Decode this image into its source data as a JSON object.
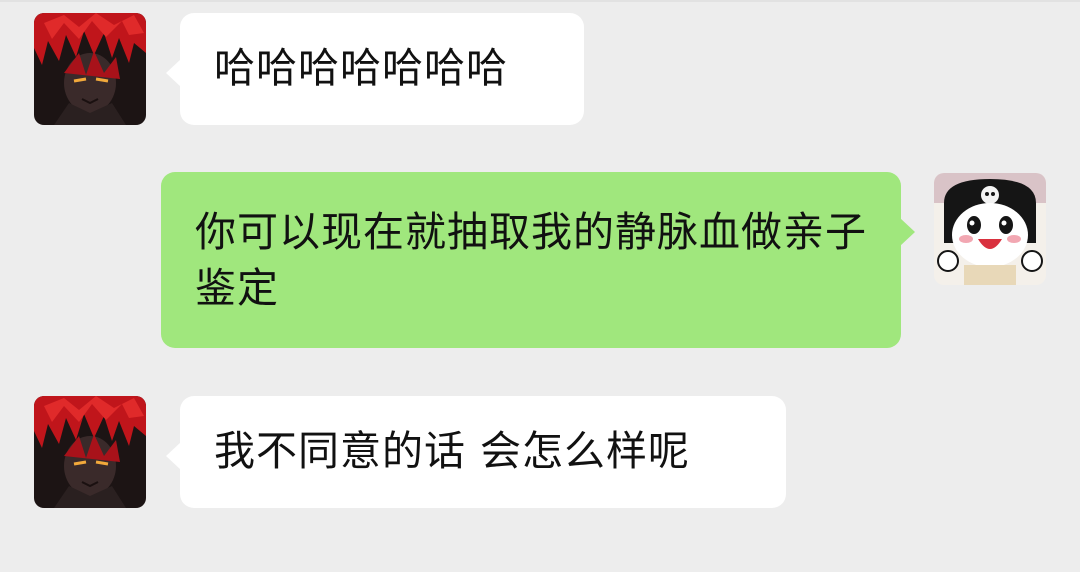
{
  "colors": {
    "background": "#ededed",
    "incoming_bubble": "#ffffff",
    "outgoing_bubble": "#a0e77d",
    "text": "#111111"
  },
  "messages": [
    {
      "direction": "incoming",
      "avatar_icon": "red-haired-anime-avatar-icon",
      "text": "哈哈哈哈哈哈哈"
    },
    {
      "direction": "outgoing",
      "avatar_icon": "panda-cartoon-avatar-icon",
      "text": "你可以现在就抽取我的静脉血做亲子鉴定"
    },
    {
      "direction": "incoming",
      "avatar_icon": "red-haired-anime-avatar-icon",
      "text": "我不同意的话 会怎么样呢"
    }
  ]
}
